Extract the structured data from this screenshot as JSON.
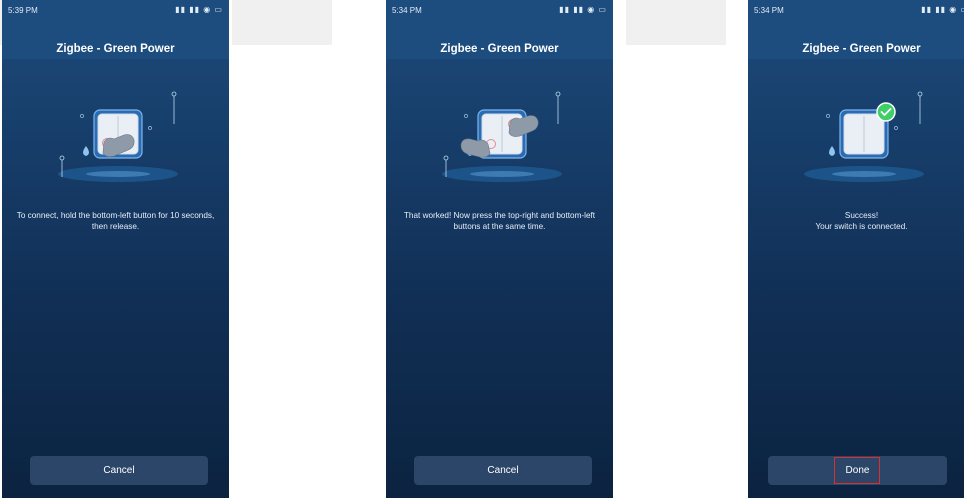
{
  "screens": [
    {
      "status_time": "5:39 PM",
      "status_icons": "▮▮ ▮▮ ◉ ▭",
      "title": "Zigbee - Green Power",
      "instruction": "To connect, hold the bottom-left button for 10 seconds, then release.",
      "button_label": "Cancel"
    },
    {
      "status_time": "5:34 PM",
      "status_icons": "▮▮ ▮▮ ◉ ▭",
      "title": "Zigbee - Green Power",
      "instruction": "That worked! Now press the top-right and bottom-left buttons at the same time.",
      "button_label": "Cancel"
    },
    {
      "status_time": "5:34 PM",
      "status_icons": "▮▮ ▮▮ ◉ ▭",
      "title": "Zigbee - Green Power",
      "instruction": "Success!\nYour switch is connected.",
      "button_label": "Done"
    }
  ],
  "colors": {
    "accent_success": "#3fcf69",
    "highlight_outline": "#d9302c"
  },
  "icons": [
    "wall-switch-icon",
    "hand-pointer-icon",
    "checkmark-badge-icon",
    "alarm-icon"
  ]
}
